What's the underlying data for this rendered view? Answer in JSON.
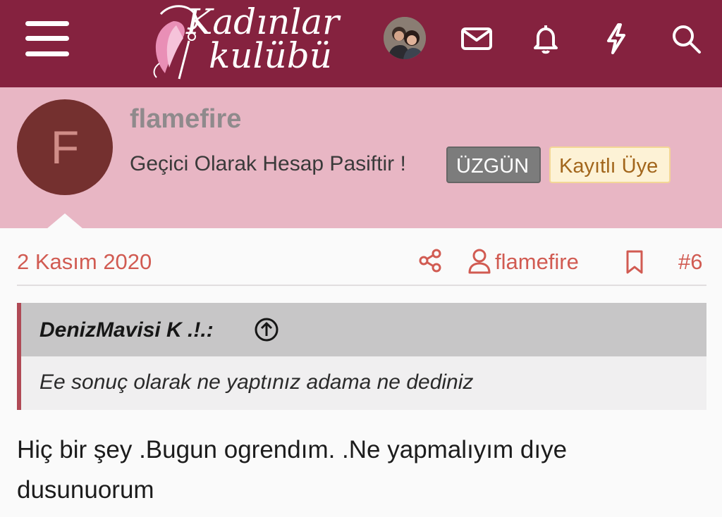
{
  "header": {
    "logo_line1": "Kadınlar",
    "logo_line2": "kulübü",
    "icons": [
      "menu-icon",
      "avatar",
      "mail-icon",
      "bell-icon",
      "lightning-icon",
      "search-icon"
    ]
  },
  "author": {
    "initial": "F",
    "username": "flamefire",
    "title": "Geçici Olarak Hesap Pasiftir !",
    "mood_badge": "ÜZGÜN",
    "role_badge": "Kayıtlı Üye"
  },
  "post": {
    "date": "2 Kasım 2020",
    "author_link": "flamefire",
    "number": "#6",
    "quote": {
      "author": "DenizMavisi K .!.:",
      "text": "Ee sonuç olarak ne yaptınız adama ne dediniz"
    },
    "body": "Hiç bir şey .Bugun ogrendım. .Ne yapmalıyım dıye dusunuorum"
  },
  "colors": {
    "header_bg": "#85223f",
    "author_band_bg": "#e8b6c4",
    "accent": "#d15b52",
    "avatar_bg": "#74302f"
  }
}
